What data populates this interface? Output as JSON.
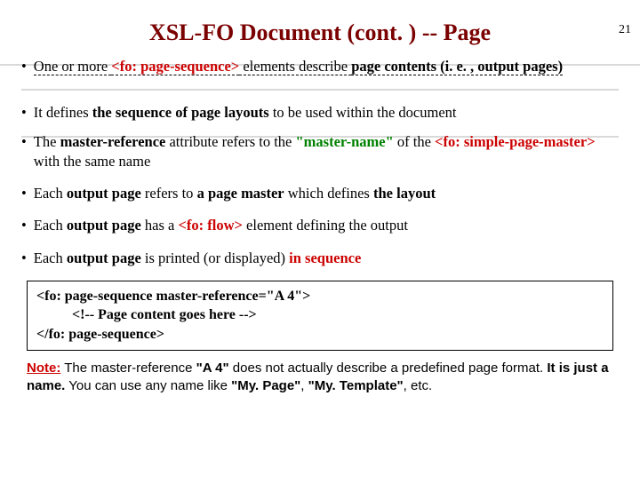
{
  "page_number": "21",
  "title": "XSL-FO Document (cont. ) -- Page",
  "bullets": {
    "b1": {
      "pre": "One or more ",
      "tag": "<fo: page-sequence>",
      "mid": " elements describe ",
      "pc": "page contents (i. e. , output pages)"
    },
    "b2": {
      "pre": "It defines ",
      "seq": "the sequence of page layouts",
      "post": " to be used within the document"
    },
    "b3": {
      "pre": "The ",
      "mr": "master-reference",
      "mid": " attribute refers to the ",
      "mn": "\"master-name\"",
      "mid2": " of the ",
      "tag": "<fo: simple-page-master>",
      "post": " with the same name"
    },
    "b4": {
      "pre": "Each ",
      "op": "output page",
      "mid": " refers to ",
      "pm": "a page master",
      "mid2": " which defines ",
      "ly": "the layout"
    },
    "b5": {
      "pre": "Each ",
      "op": "output page",
      "mid": " has a ",
      "tag": "<fo: flow>",
      "post": " element defining the output"
    },
    "b6": {
      "pre": "Each ",
      "op": "output page",
      "mid": " is printed (or displayed) ",
      "seq": "in sequence"
    }
  },
  "code": {
    "l1a": "<fo: page-sequence ",
    "l1b": "master-reference=\"A 4\">",
    "l2": "<!-- Page content goes here -->",
    "l3": "</fo: page-sequence>"
  },
  "note": {
    "n_label": "Note:",
    "t1": " The master-reference ",
    "a4": "\"A 4\"",
    "t2": " does not actually describe a predefined page format. ",
    "just": "It is just a name.",
    "t3": " You can use any name like ",
    "ex1": "\"My. Page\"",
    "c1": ", ",
    "ex2": "\"My. Template\"",
    "t4": ", etc."
  }
}
